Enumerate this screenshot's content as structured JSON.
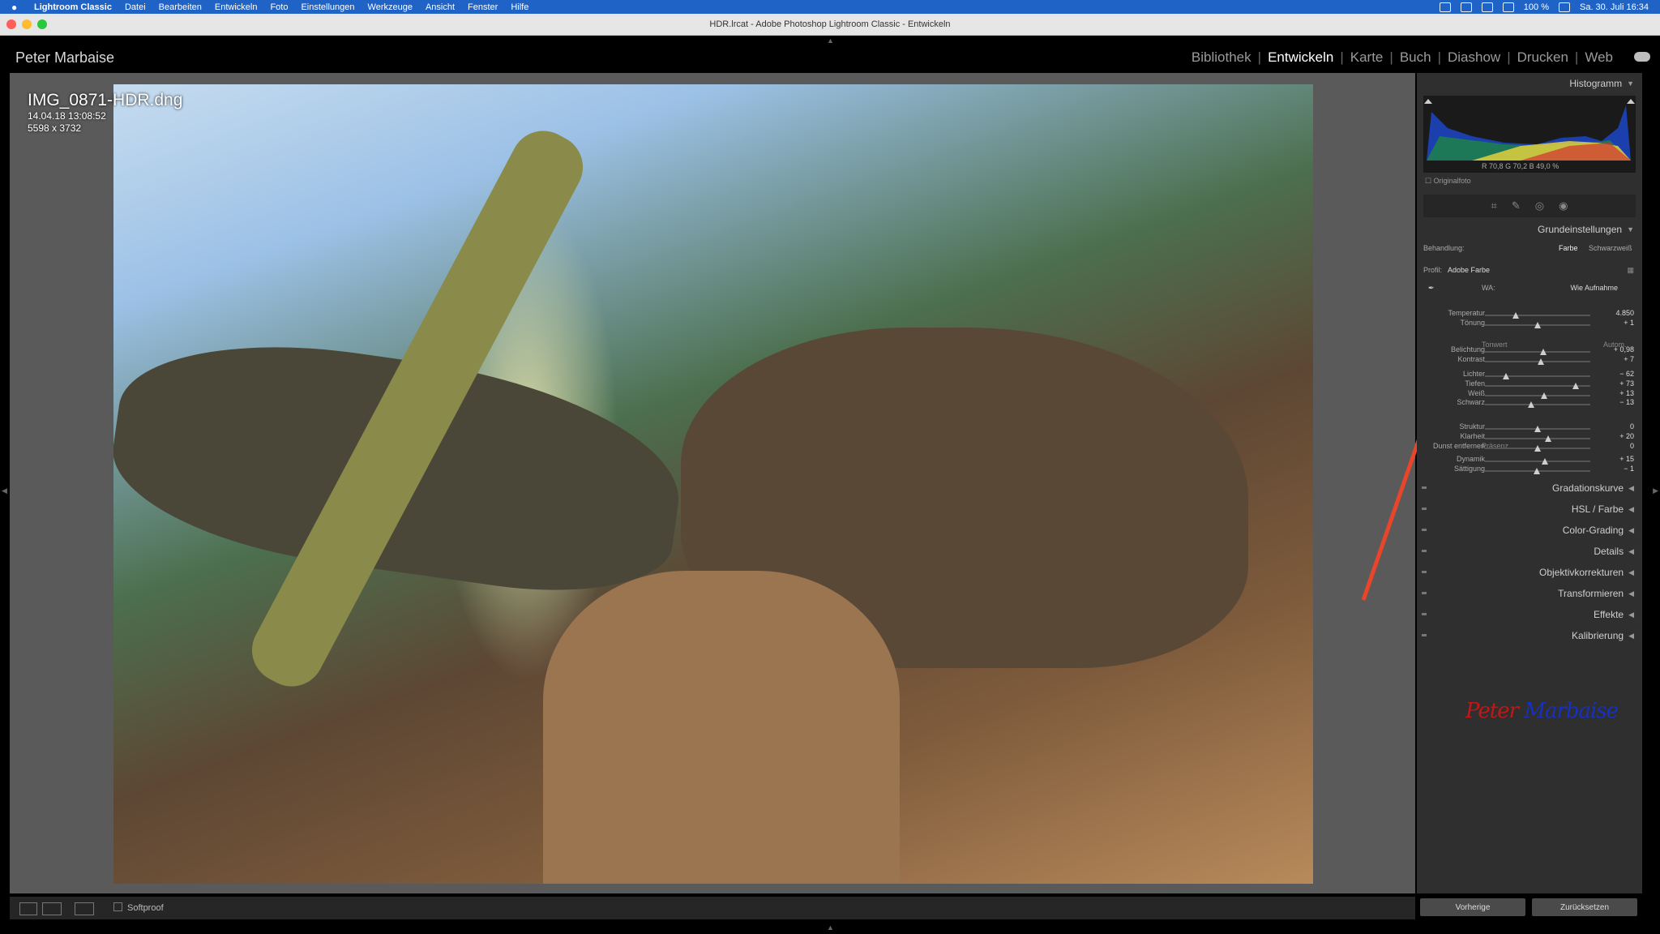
{
  "menubar": {
    "app": "Lightroom Classic",
    "items": [
      "Datei",
      "Bearbeiten",
      "Entwickeln",
      "Foto",
      "Einstellungen",
      "Werkzeuge",
      "Ansicht",
      "Fenster",
      "Hilfe"
    ],
    "battery": "100 %",
    "datetime": "Sa. 30. Juli  16:34"
  },
  "window": {
    "title": "HDR.lrcat - Adobe Photoshop Lightroom Classic - Entwickeln"
  },
  "identity": {
    "name": "Peter Marbaise"
  },
  "modules": [
    "Bibliothek",
    "Entwickeln",
    "Karte",
    "Buch",
    "Diashow",
    "Drucken",
    "Web"
  ],
  "photo": {
    "filename": "IMG_0871-HDR.dng",
    "datetime": "14.04.18 13:08:52",
    "dimensions": "5598 x 3732"
  },
  "histogram": {
    "title": "Histogramm",
    "r_label": "R",
    "r": "70,8",
    "g_label": "G",
    "g": "70,2",
    "b_label": "B",
    "b": "49,0 %",
    "original": "Originalfoto"
  },
  "basic": {
    "title": "Grundeinstellungen",
    "treatment_label": "Behandlung:",
    "treatment_color": "Farbe",
    "treatment_bw": "Schwarzweiß",
    "profile_label": "Profil:",
    "profile_value": "Adobe Farbe",
    "wb_label": "WA:",
    "wb_value": "Wie Aufnahme",
    "tone_label": "Tonwert",
    "tone_auto": "Autom.",
    "presence_label": "Präsenz",
    "sliders": [
      {
        "label": "Temperatur",
        "value": "4.850",
        "pos": 0.29
      },
      {
        "label": "Tönung",
        "value": "+ 1",
        "pos": 0.5
      },
      {
        "label": "Belichtung",
        "value": "+ 0,98",
        "pos": 0.55
      },
      {
        "label": "Kontrast",
        "value": "+ 7",
        "pos": 0.53
      },
      {
        "label": "Lichter",
        "value": "− 62",
        "pos": 0.2
      },
      {
        "label": "Tiefen",
        "value": "+ 73",
        "pos": 0.86
      },
      {
        "label": "Weiß",
        "value": "+ 13",
        "pos": 0.56
      },
      {
        "label": "Schwarz",
        "value": "− 13",
        "pos": 0.44
      },
      {
        "label": "Struktur",
        "value": "0",
        "pos": 0.5
      },
      {
        "label": "Klarheit",
        "value": "+ 20",
        "pos": 0.6
      },
      {
        "label": "Dunst entfernen",
        "value": "0",
        "pos": 0.5
      },
      {
        "label": "Dynamik",
        "value": "+ 15",
        "pos": 0.57
      },
      {
        "label": "Sättigung",
        "value": "− 1",
        "pos": 0.49
      }
    ]
  },
  "panels": [
    "Gradationskurve",
    "HSL / Farbe",
    "Color-Grading",
    "Details",
    "Objektivkorrekturen",
    "Transformieren",
    "Effekte",
    "Kalibrierung"
  ],
  "signature": "Peter Marbaise",
  "toolbar": {
    "softproof": "Softproof"
  },
  "buttons": {
    "previous": "Vorherige",
    "reset": "Zurücksetzen"
  }
}
